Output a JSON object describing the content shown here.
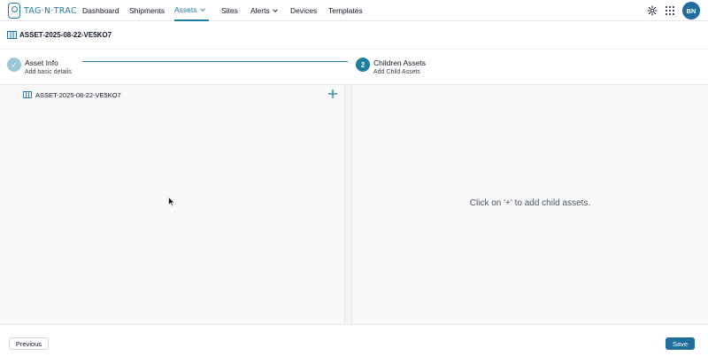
{
  "app": {
    "logo_text": "TAG·N·TRAC"
  },
  "nav": {
    "items": [
      {
        "label": "Dashboard"
      },
      {
        "label": "Shipments"
      },
      {
        "label": "Assets"
      },
      {
        "label": "Sites"
      },
      {
        "label": "Alerts"
      },
      {
        "label": "Devices"
      },
      {
        "label": "Templates"
      }
    ],
    "active": "Assets",
    "icons": {
      "settings": "gear-icon",
      "apps": "grid-icon"
    },
    "avatar_initials": "BN"
  },
  "page": {
    "title": "ASSET-2025-08-22-VE5KO7",
    "title_icon": "asset-icon"
  },
  "stepper": {
    "steps": [
      {
        "number": "✓",
        "title": "Asset Info",
        "subtitle": "Add basic details",
        "state": "completed"
      },
      {
        "number": "2",
        "title": "Children Assets",
        "subtitle": "Add Child Assets",
        "state": "active"
      }
    ]
  },
  "tree": {
    "root": {
      "label": "ASSET-2025-08-22-VE5KO7",
      "icon": "asset-icon"
    },
    "add_icon": "plus-icon"
  },
  "right_panel": {
    "empty_message": "Click on '+' to add child assets."
  },
  "footer": {
    "previous_label": "Previous",
    "save_label": "Save"
  },
  "colors": {
    "accent": "#1f7ea0",
    "save_bg": "#1f6f9a",
    "completed_step": "#9cc7d8"
  }
}
